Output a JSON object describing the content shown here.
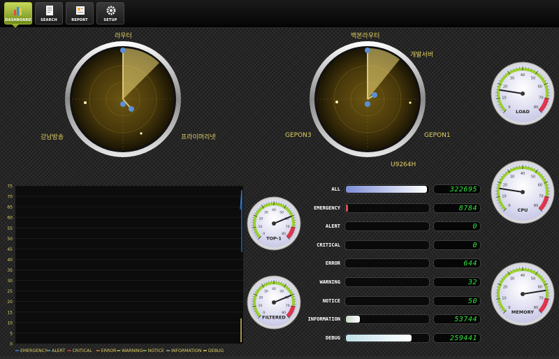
{
  "toolbar": {
    "buttons": [
      {
        "label": "DASHBOARD",
        "icon": "bar-chart-icon",
        "active": true
      },
      {
        "label": "SEARCH",
        "icon": "document-icon",
        "active": false
      },
      {
        "label": "REPORT",
        "icon": "report-icon",
        "active": false
      },
      {
        "label": "SETUP",
        "icon": "gear-icon",
        "active": false
      }
    ]
  },
  "radars": [
    {
      "labels": {
        "top": "라우터",
        "left": "강남방송",
        "right": "프라이머리넷"
      }
    },
    {
      "labels": {
        "top": "백본라우터",
        "topright": "개발서버",
        "left": "GEPON3",
        "right": "GEPON1",
        "bottom": "U9264H"
      }
    }
  ],
  "gauges": {
    "load": {
      "label": "LOAD",
      "value": 0.2
    },
    "cpu": {
      "label": "CPU",
      "value": 0.2
    },
    "memory": {
      "label": "MEMORY",
      "value": 0.8
    },
    "top1": {
      "label": "TOP-1",
      "value": 0.75
    },
    "filtered": {
      "label": "FILTERED",
      "value": 0.75
    }
  },
  "stats": [
    {
      "label": "ALL",
      "value": "322695",
      "fill": 0.98,
      "color": "#7d8ed6"
    },
    {
      "label": "EMERGENCY",
      "value": "8784",
      "fill": 0.02,
      "color": "#d9534f"
    },
    {
      "label": "ALERT",
      "value": "0",
      "fill": 0,
      "color": "#999999"
    },
    {
      "label": "CRITICAL",
      "value": "0",
      "fill": 0,
      "color": "#999999"
    },
    {
      "label": "ERROR",
      "value": "644",
      "fill": 0,
      "color": "#999999"
    },
    {
      "label": "WARNING",
      "value": "32",
      "fill": 0,
      "color": "#999999"
    },
    {
      "label": "NOTICE",
      "value": "50",
      "fill": 0,
      "color": "#999999"
    },
    {
      "label": "INFORMATION",
      "value": "53744",
      "fill": 0.17,
      "color": "#c8dac8"
    },
    {
      "label": "DEBUG",
      "value": "259441",
      "fill": 0.8,
      "color": "#bfe0e8"
    }
  ],
  "chart_data": {
    "type": "line",
    "ylim": [
      0,
      75
    ],
    "yticks": [
      0,
      5,
      10,
      15,
      20,
      25,
      30,
      35,
      40,
      45,
      50,
      55,
      60,
      65,
      70,
      75
    ],
    "grid": true,
    "legend_position": "bottom",
    "series": [
      {
        "name": "EMERGENCY",
        "color": "#3a7fd0",
        "spike": 73
      },
      {
        "name": "ALERT",
        "color": "#4fb0c6",
        "spike": 0
      },
      {
        "name": "CRITICAL",
        "color": "#d04848",
        "spike": 0
      },
      {
        "name": "ERROR",
        "color": "#d08a30",
        "spike": 0
      },
      {
        "name": "WARNING",
        "color": "#b8c040",
        "spike": 0
      },
      {
        "name": "NOTICE",
        "color": "#7bd07b",
        "spike": 0
      },
      {
        "name": "INFORMATION",
        "color": "#a0a0a0",
        "spike": 0
      },
      {
        "name": "DEBUG",
        "color": "#e0d060",
        "spike": 12
      }
    ]
  }
}
